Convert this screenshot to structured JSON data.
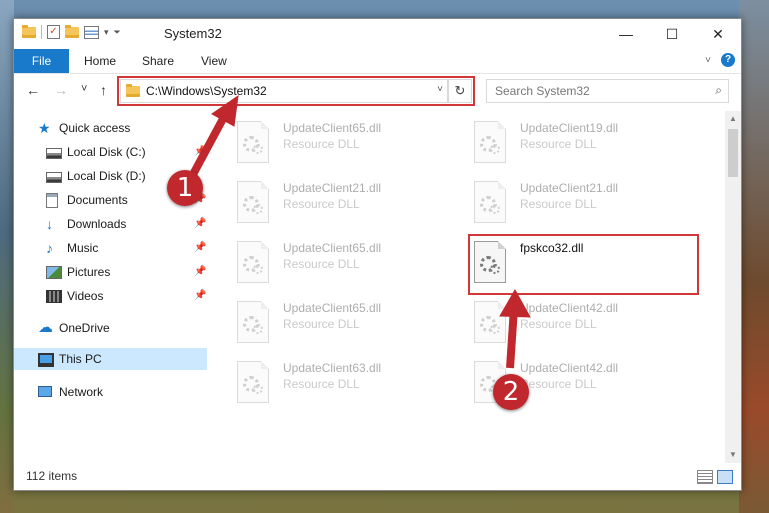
{
  "window": {
    "title": "System32",
    "controls": {
      "minimize": "—",
      "maximize": "☐",
      "close": "✕"
    }
  },
  "ribbon": {
    "tabs": [
      "File",
      "Home",
      "Share",
      "View"
    ],
    "collapse_icon": "chevron-down-icon",
    "help_label": "?"
  },
  "nav": {
    "back": "←",
    "forward": "→",
    "recent": "˅",
    "up": "↑",
    "address": "C:\\Windows\\System32",
    "address_dropdown": "˅",
    "refresh": "↻",
    "search_placeholder": "Search System32",
    "search_icon": "⌕"
  },
  "sidebar": {
    "items": [
      {
        "label": "Quick access",
        "icon": "star-icon",
        "pinned": false
      },
      {
        "label": "Local Disk (C:)",
        "icon": "disk-icon",
        "pinned": true
      },
      {
        "label": "Local Disk (D:)",
        "icon": "disk-icon",
        "pinned": false
      },
      {
        "label": "Documents",
        "icon": "documents-icon",
        "pinned": true
      },
      {
        "label": "Downloads",
        "icon": "download-icon",
        "pinned": true
      },
      {
        "label": "Music",
        "icon": "music-icon",
        "pinned": true
      },
      {
        "label": "Pictures",
        "icon": "pictures-icon",
        "pinned": true
      },
      {
        "label": "Videos",
        "icon": "videos-icon",
        "pinned": true
      },
      {
        "label": "OneDrive",
        "icon": "cloud-icon",
        "pinned": false
      },
      {
        "label": "This PC",
        "icon": "computer-icon",
        "pinned": false,
        "selected": true
      },
      {
        "label": "Network",
        "icon": "network-icon",
        "pinned": false
      }
    ],
    "pin_glyph": "📌"
  },
  "files": [
    {
      "name": "UpdateClient65.dll",
      "type": "Resource DLL"
    },
    {
      "name": "UpdateClient19.dll",
      "type": "Resource DLL"
    },
    {
      "name": "UpdateClient21.dll",
      "type": "Resource DLL"
    },
    {
      "name": "UpdateClient21.dll",
      "type": "Resource DLL"
    },
    {
      "name": "UpdateClient65.dll",
      "type": "Resource DLL"
    },
    {
      "name": "fpskco32.dll",
      "type": "",
      "highlighted": true
    },
    {
      "name": "UpdateClient65.dll",
      "type": "Resource DLL"
    },
    {
      "name": "UpdateClient42.dll",
      "type": "Resource DLL"
    },
    {
      "name": "UpdateClient63.dll",
      "type": "Resource DLL"
    },
    {
      "name": "UpdateClient42.dll",
      "type": "Resource DLL"
    }
  ],
  "status": {
    "item_count": "112 items"
  },
  "annotations": {
    "step1": "1",
    "step2": "2",
    "color": "#c0282d"
  }
}
